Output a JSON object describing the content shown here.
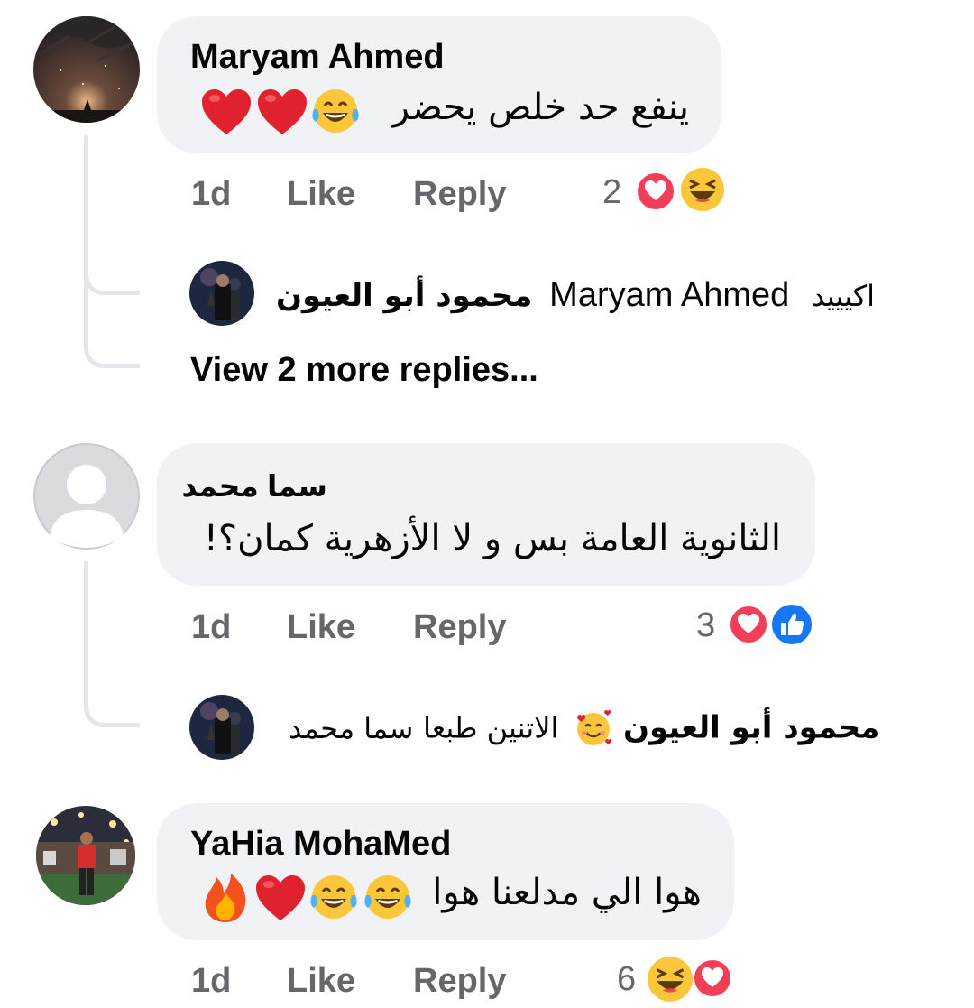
{
  "comments": [
    {
      "author": "Maryam Ahmed",
      "text": "ينفع حد خلص يحضر",
      "time": "1d",
      "like_label": "Like",
      "reply_label": "Reply",
      "reaction_count": "2",
      "reactions": [
        "love",
        "haha"
      ],
      "reply": {
        "author": "محمود أبو العيون",
        "tag": "Maryam Ahmed",
        "text": "اكيييد"
      },
      "view_more": "View 2 more replies..."
    },
    {
      "author": "سما محمد",
      "text": "الثانوية العامة بس و لا الأزهرية كمان؟!",
      "time": "1d",
      "like_label": "Like",
      "reply_label": "Reply",
      "reaction_count": "3",
      "reactions": [
        "love",
        "like"
      ],
      "reply": {
        "author": "محمود أبو العيون",
        "text": "الاتنين طبعا",
        "tag": "سما محمد"
      }
    },
    {
      "author": "YaHia MohaMed",
      "text": "هوا الي مدلعنا هوا",
      "time": "1d",
      "like_label": "Like",
      "reply_label": "Reply",
      "reaction_count": "6",
      "reactions": [
        "haha",
        "love"
      ]
    }
  ],
  "colors": {
    "bubble": "#f0f2f5",
    "meta_text": "#65676b",
    "love": "#f33e58",
    "like": "#1877f2",
    "haha": "#fcc63a",
    "thread_line": "#e4e6eb"
  }
}
